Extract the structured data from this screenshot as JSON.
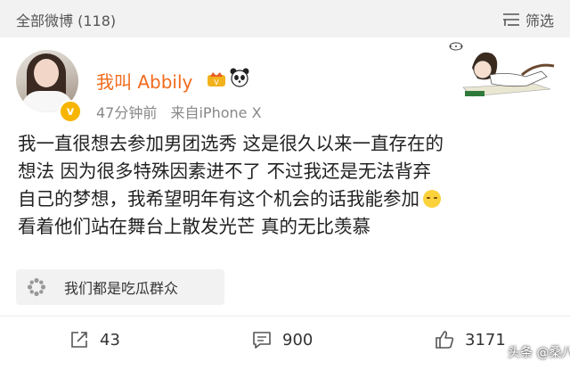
{
  "topbar": {
    "title": "全部微博 (118)",
    "filter_label": "筛选"
  },
  "user": {
    "name": "我叫 Abbily",
    "verified_badge": "v"
  },
  "meta": {
    "time": "47分钟前",
    "source": "来自iPhone X"
  },
  "post": {
    "lines": [
      "我一直很想去参加男团选秀 这是很久以来一直存在的",
      "想法 因为很多特殊因素进不了 不过我还是无法背弃",
      "自己的梦想，我希望明年有这个机会的话我能参加",
      "看着他们站在舞台上散发光芒 真的无比羡慕"
    ]
  },
  "topic": {
    "label": "我们都是吃瓜群众"
  },
  "actions": {
    "repost_count": "43",
    "comment_count": "900",
    "like_count": "3171"
  },
  "watermark": "头条 @桑八鲜",
  "colors": {
    "username": "#f26b1d",
    "badge": "#f7b500",
    "topbar_bg": "#f2f2f2"
  },
  "icons": {
    "filter": "filter-icon",
    "repost": "share-icon",
    "comment": "comment-icon",
    "like": "thumbs-up-icon",
    "topic": "flower-icon",
    "crown": "crown-icon",
    "panda": "panda-icon",
    "sticker": "girl-lying-sticker-icon",
    "emoji": "sad-face-emoji-icon"
  }
}
